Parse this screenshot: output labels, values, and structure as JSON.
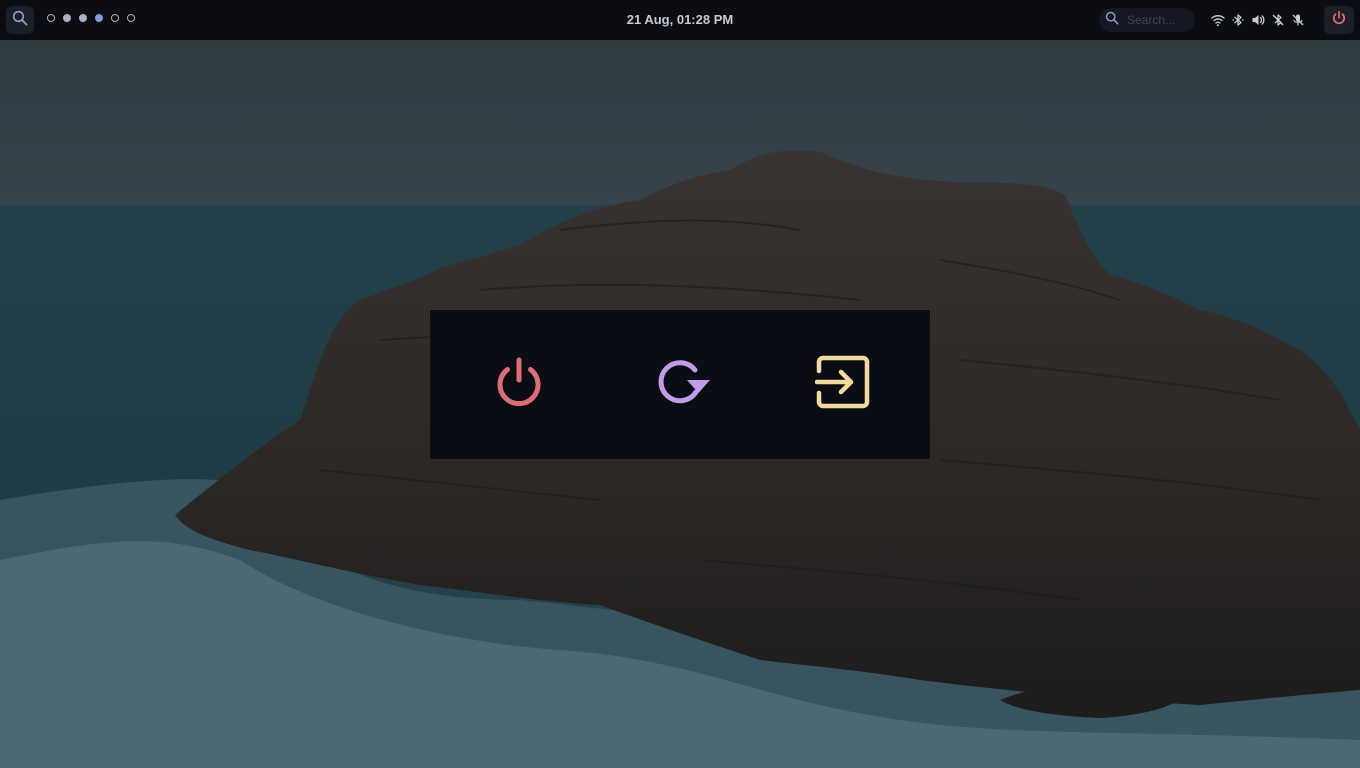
{
  "topbar": {
    "search_icon": "search-icon",
    "workspaces": [
      {
        "state": "empty"
      },
      {
        "state": "occupied"
      },
      {
        "state": "occupied"
      },
      {
        "state": "active"
      },
      {
        "state": "empty"
      },
      {
        "state": "empty"
      }
    ],
    "clock": "21 Aug, 01:28 PM",
    "search": {
      "placeholder": "Search..."
    },
    "tray_icons": [
      "wifi-icon",
      "bluetooth-icon",
      "volume-icon",
      "bluetooth-off-icon",
      "mic-off-icon"
    ],
    "power_icon": "power-icon"
  },
  "power_menu": {
    "buttons": [
      {
        "icon": "shutdown-icon",
        "color": "#e06c75"
      },
      {
        "icon": "reboot-icon",
        "color": "#c49be8"
      },
      {
        "icon": "logout-icon",
        "color": "#f4d99c"
      }
    ]
  },
  "colors": {
    "bar_bg": "#0b0d13",
    "menu_bg": "#0b0d15",
    "clock_text": "#c7cbd6",
    "workspace_active": "#7f9ed8",
    "power_red": "#e06c75"
  }
}
